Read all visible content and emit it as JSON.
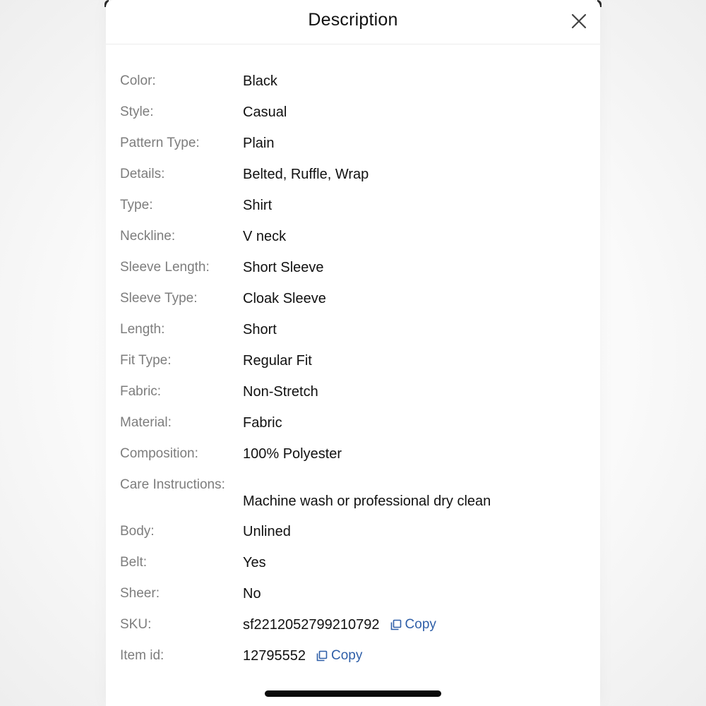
{
  "header": {
    "title": "Description"
  },
  "attributes": [
    {
      "label": "Color:",
      "value": "Black"
    },
    {
      "label": "Style:",
      "value": "Casual"
    },
    {
      "label": "Pattern Type:",
      "value": "Plain"
    },
    {
      "label": "Details:",
      "value": "Belted, Ruffle, Wrap"
    },
    {
      "label": "Type:",
      "value": "Shirt"
    },
    {
      "label": "Neckline:",
      "value": "V neck"
    },
    {
      "label": "Sleeve Length:",
      "value": "Short Sleeve"
    },
    {
      "label": "Sleeve Type:",
      "value": "Cloak Sleeve"
    },
    {
      "label": "Length:",
      "value": "Short"
    },
    {
      "label": "Fit Type:",
      "value": "Regular Fit"
    },
    {
      "label": "Fabric:",
      "value": "Non-Stretch"
    },
    {
      "label": "Material:",
      "value": "Fabric"
    },
    {
      "label": "Composition:",
      "value": "100% Polyester"
    },
    {
      "label": "Care Instructions:",
      "value": "Machine wash or professional dry clean"
    },
    {
      "label": "Body:",
      "value": "Unlined"
    },
    {
      "label": "Belt:",
      "value": "Yes"
    },
    {
      "label": "Sheer:",
      "value": "No"
    }
  ],
  "sku": {
    "label": "SKU:",
    "value": "sf2212052799210792",
    "copy_label": "Copy"
  },
  "item_id": {
    "label": "Item id:",
    "value": "12795552",
    "copy_label": "Copy"
  },
  "colors": {
    "label_text": "#7d7d7d",
    "value_text": "#111111",
    "link": "#2f5fa8"
  },
  "icons": {
    "close": "close-icon",
    "copy": "copy-icon"
  }
}
